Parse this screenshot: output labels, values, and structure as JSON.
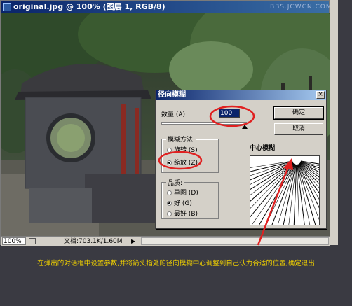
{
  "document": {
    "title": "original.jpg @ 100% (图层 1, RGB/8)",
    "watermark": "BBS.JCWCN.COM",
    "zoom": "100%",
    "doc_size": "文档:703.1K/1.60M"
  },
  "dialog": {
    "title": "径向模糊",
    "close_label": "×",
    "amount_label": "数量 (A)",
    "amount_value": "100",
    "ok_label": "确定",
    "cancel_label": "取消",
    "blur_method": {
      "label": "模糊方法:",
      "options": [
        "旋转 (S)",
        "缩放 (Z)"
      ],
      "selected": "缩放 (Z)"
    },
    "quality": {
      "label": "品质:",
      "options": [
        "草图 (D)",
        "好 (G)",
        "最好 (B)"
      ],
      "selected": "好 (G)"
    },
    "blur_center_label": "中心模糊"
  },
  "annotation": "在弹出的对话框中设置参数,并将箭头指处的径向模糊中心调整到自己认为合适的位置,确定退出",
  "colors": {
    "highlight_circle": "#e02020",
    "annotation_text": "#f0d000",
    "titlebar": "#0a246a"
  }
}
